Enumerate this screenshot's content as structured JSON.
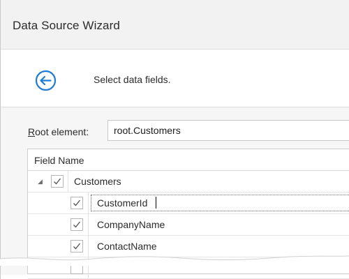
{
  "window": {
    "title": "Data Source Wizard"
  },
  "header": {
    "subtitle": "Select data fields."
  },
  "root": {
    "label_u": "R",
    "label_rest": "oot element:",
    "value": "root.Customers"
  },
  "tree": {
    "column_header": "Field Name",
    "rows": [
      {
        "label": "Customers",
        "checked": true
      },
      {
        "label": "CustomerId",
        "checked": true
      },
      {
        "label": "CompanyName",
        "checked": true
      },
      {
        "label": "ContactName",
        "checked": true
      }
    ]
  },
  "icons": {
    "back": "arrow-left-circle-icon",
    "expander": "triangle-expanded-icon",
    "check": "checkmark-icon"
  },
  "colors": {
    "accent": "#1e7bd6"
  }
}
